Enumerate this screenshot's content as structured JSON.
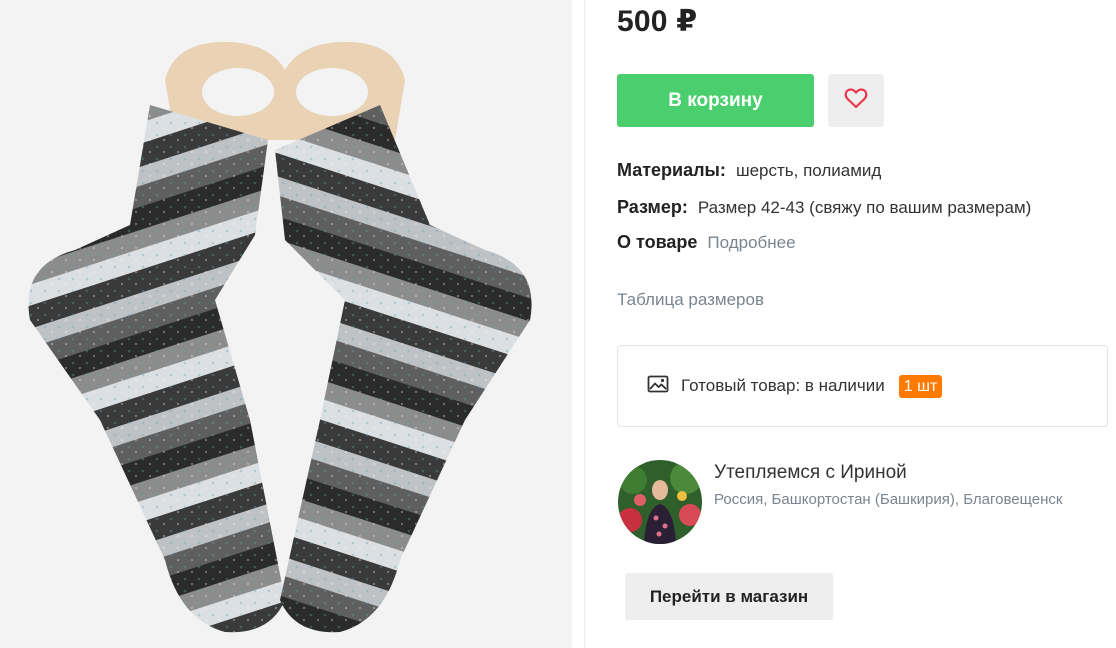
{
  "product": {
    "price": "500 ₽",
    "cart_label": "В корзину",
    "favorite_icon": "heart-icon"
  },
  "properties": {
    "materials_label": "Материалы:",
    "materials_value": "шерсть, полиамид",
    "size_label": "Размер:",
    "size_value": "Размер 42-43 (свяжу по вашим размерам)",
    "about_label": "О товаре",
    "about_link": "Подробнее"
  },
  "size_table_link": "Таблица размеров",
  "stock": {
    "icon": "image-icon",
    "text": "Готовый товар: в наличии",
    "badge": "1 шт",
    "badge_color": "#ff7a00"
  },
  "shop": {
    "name": "Утепляемся с Ириной",
    "location": "Россия, Башкортостан (Башкирия), Благовещенск",
    "button_label": "Перейти в магазин"
  },
  "colors": {
    "accent_green": "#4bcf6e",
    "heart_red": "#e8384f",
    "muted_text": "#7a8590"
  }
}
